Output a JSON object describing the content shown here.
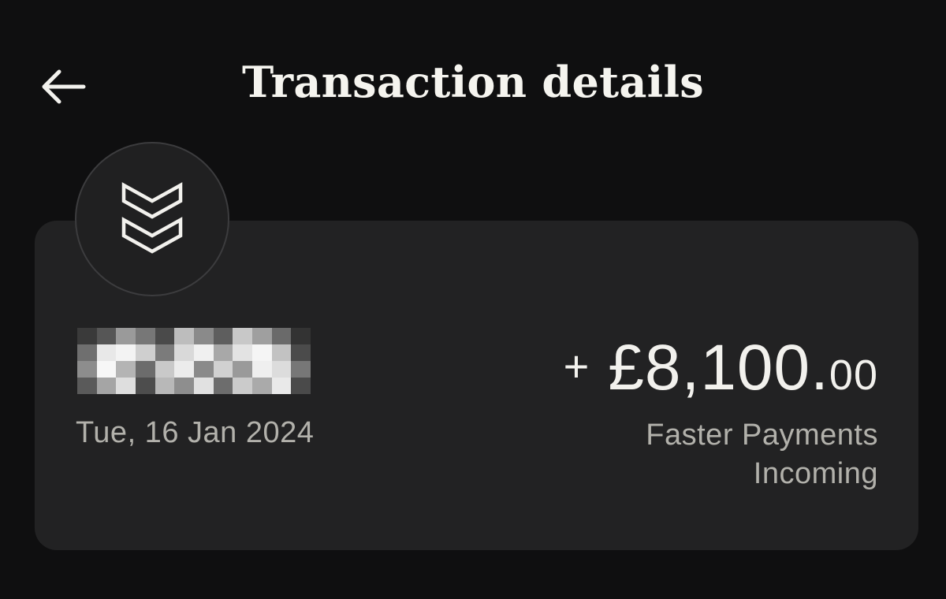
{
  "header": {
    "title": "Transaction details",
    "back_icon": "arrow-left-icon"
  },
  "transaction": {
    "avatar_icon": "double-chevron-down-icon",
    "counterparty_name": "",
    "counterparty_redacted": true,
    "date": "Tue, 16 Jan 2024",
    "amount_sign": "+",
    "amount_main": "£8,100.",
    "amount_cents": "00",
    "payment_type_line1": "Faster Payments",
    "payment_type_line2": "Incoming"
  },
  "colors": {
    "background": "#0f0f10",
    "card": "#222223",
    "primary_text": "#f2f1ed",
    "secondary_text": "#b2b1ab"
  }
}
